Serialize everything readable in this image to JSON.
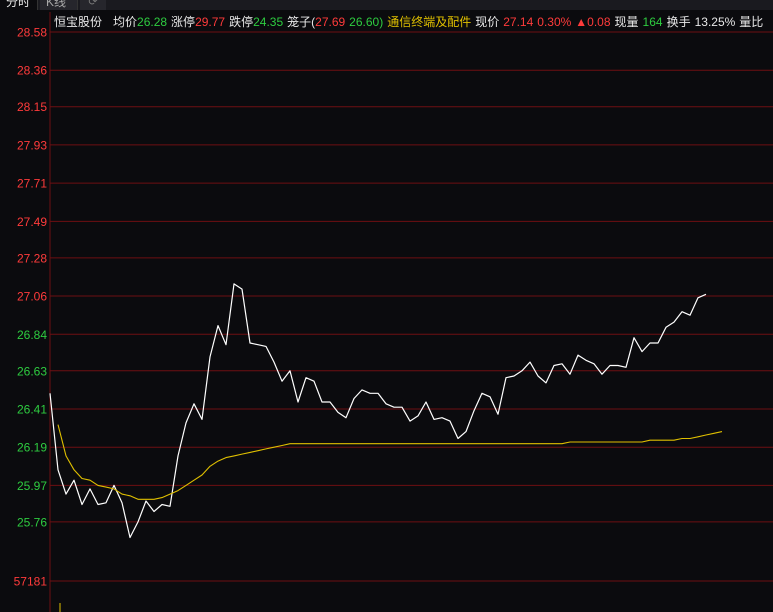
{
  "tabs": [
    {
      "label": "分时"
    },
    {
      "label": "K线"
    },
    {
      "label": "⟳"
    }
  ],
  "header": {
    "stock_name": "恒宝股份",
    "avg_label": "均价",
    "avg_value": "26.28",
    "limit_up_label": "涨停",
    "limit_up_value": "29.77",
    "limit_down_label": "跌停",
    "limit_down_value": "24.35",
    "bidask_label": "笼子(",
    "bidask_high": "27.69",
    "bidask_low": "26.60)",
    "industry": "通信终端及配件",
    "price_label": "现价",
    "price_value": "27.14",
    "change_pct": "0.30%",
    "change_abs": "▲0.08",
    "volume_label": "现量",
    "volume_value": "164",
    "turnover_label": "换手",
    "turnover_value": "13.25%",
    "ratio_label": "量比"
  },
  "colors": {
    "background": "#0b0b0e",
    "grid": "#6e0f12",
    "price_line": "#ffffff",
    "avg_line": "#e0c000",
    "up": "#ff3b3b",
    "down": "#2ecc40"
  },
  "chart_data": {
    "type": "line",
    "ylim": [
      25.65,
      28.58
    ],
    "y_ticks": [
      {
        "label": "28.58",
        "value": 28.58,
        "color": "#ff3b3b"
      },
      {
        "label": "28.36",
        "value": 28.36,
        "color": "#ff3b3b"
      },
      {
        "label": "28.15",
        "value": 28.15,
        "color": "#ff3b3b"
      },
      {
        "label": "27.93",
        "value": 27.93,
        "color": "#ff3b3b"
      },
      {
        "label": "27.71",
        "value": 27.71,
        "color": "#ff3b3b"
      },
      {
        "label": "27.49",
        "value": 27.49,
        "color": "#ff3b3b"
      },
      {
        "label": "27.28",
        "value": 27.28,
        "color": "#ff3b3b"
      },
      {
        "label": "27.06",
        "value": 27.06,
        "color": "#ff3b3b"
      },
      {
        "label": "26.84",
        "value": 26.84,
        "color": "#2ecc40"
      },
      {
        "label": "26.63",
        "value": 26.63,
        "color": "#2ecc40"
      },
      {
        "label": "26.41",
        "value": 26.41,
        "color": "#2ecc40"
      },
      {
        "label": "26.19",
        "value": 26.19,
        "color": "#2ecc40"
      },
      {
        "label": "25.97",
        "value": 25.97,
        "color": "#2ecc40"
      },
      {
        "label": "25.76",
        "value": 25.76,
        "color": "#2ecc40"
      }
    ],
    "volume_tick": {
      "label": "57181",
      "value": 57181,
      "color": "#ff3b3b"
    },
    "series": [
      {
        "values": [
          26.5,
          26.06,
          25.92,
          26.0,
          25.86,
          25.95,
          25.86,
          25.87,
          25.97,
          25.87,
          25.67,
          25.76,
          25.88,
          25.82,
          25.86,
          25.85,
          26.14,
          26.33,
          26.44,
          26.35,
          26.71,
          26.89,
          26.78,
          27.13,
          27.1,
          26.79,
          26.78,
          26.77,
          26.68,
          26.57,
          26.63,
          26.45,
          26.59,
          26.57,
          26.45,
          26.45,
          26.39,
          26.36,
          26.47,
          26.52,
          26.5,
          26.5,
          26.44,
          26.42,
          26.42,
          26.34,
          26.37,
          26.45,
          26.35,
          26.36,
          26.34,
          26.24,
          26.28,
          26.4,
          26.5,
          26.48,
          26.38,
          26.59,
          26.6,
          26.63,
          26.68,
          26.6,
          26.56,
          26.66,
          26.67,
          26.61,
          26.72,
          26.69,
          26.67,
          26.61,
          26.66,
          26.66,
          26.65,
          26.82,
          26.74,
          26.79,
          26.79,
          26.88,
          26.91,
          26.97,
          26.95,
          27.05,
          27.07
        ]
      },
      {
        "values": [
          26.32,
          26.14,
          26.06,
          26.01,
          26.0,
          25.97,
          25.96,
          25.95,
          25.92,
          25.91,
          25.89,
          25.89,
          25.89,
          25.9,
          25.92,
          25.94,
          25.97,
          26.0,
          26.03,
          26.08,
          26.11,
          26.13,
          26.14,
          26.15,
          26.16,
          26.17,
          26.18,
          26.19,
          26.2,
          26.21,
          26.21,
          26.21,
          26.21,
          26.21,
          26.21,
          26.21,
          26.21,
          26.21,
          26.21,
          26.21,
          26.21,
          26.21,
          26.21,
          26.21,
          26.21,
          26.21,
          26.21,
          26.21,
          26.21,
          26.21,
          26.21,
          26.21,
          26.21,
          26.21,
          26.21,
          26.21,
          26.21,
          26.21,
          26.21,
          26.21,
          26.21,
          26.21,
          26.21,
          26.21,
          26.22,
          26.22,
          26.22,
          26.22,
          26.22,
          26.22,
          26.22,
          26.22,
          26.22,
          26.22,
          26.23,
          26.23,
          26.23,
          26.23,
          26.24,
          26.24,
          26.25,
          26.26,
          26.27,
          26.28
        ]
      }
    ]
  }
}
